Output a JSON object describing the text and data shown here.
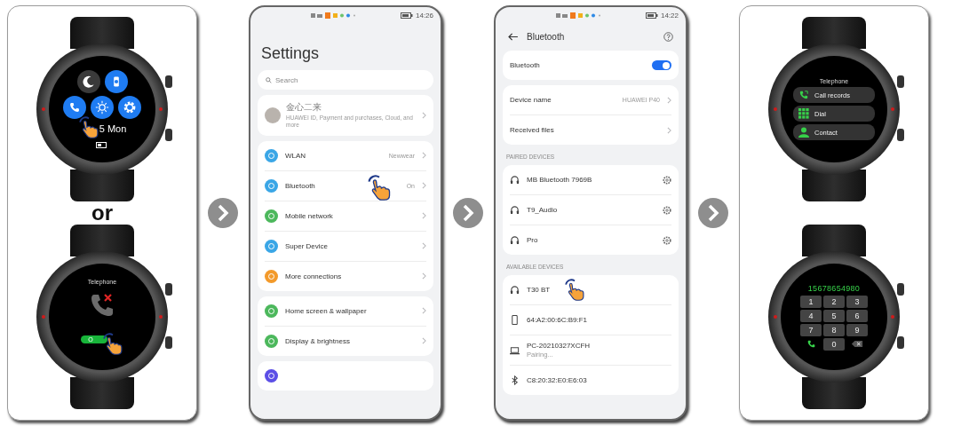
{
  "step_1": {
    "quick_menu_watch": {
      "date": "5 Mon",
      "tap": true
    },
    "separator": "or",
    "call_watch": {
      "title": "Telephone",
      "button_label": "O",
      "tap": true
    }
  },
  "step_2": {
    "status_time": "14:26",
    "title": "Settings",
    "search": {
      "placeholder": "Search"
    },
    "account": {
      "name": "金心二来",
      "subtitle": "HUAWEI ID, Payment and purchases, Cloud, and more"
    },
    "groups": [
      [
        {
          "label": "WLAN",
          "value": "Newwear",
          "color": "#3aa6e6",
          "tap": false
        },
        {
          "label": "Bluetooth",
          "value": "On",
          "color": "#3aa6e6",
          "tap": true
        },
        {
          "label": "Mobile network",
          "color": "#4cb85c",
          "tap": false
        },
        {
          "label": "Super Device",
          "color": "#3aa6e6",
          "tap": false
        },
        {
          "label": "More connections",
          "color": "#f39a2b",
          "tap": false
        }
      ],
      [
        {
          "label": "Home screen & wallpaper",
          "color": "#4cb85c",
          "tap": false
        },
        {
          "label": "Display & brightness",
          "color": "#4cb85c",
          "tap": false
        }
      ],
      [
        {
          "color": "#5b4ee6",
          "tap": false
        }
      ]
    ]
  },
  "step_3": {
    "status_time": "14:22",
    "title": "Bluetooth",
    "bluetooth": {
      "label": "Bluetooth",
      "on": true
    },
    "settings": [
      {
        "label": "Device name",
        "value": "HUAWEI P40"
      },
      {
        "label": "Received files"
      }
    ],
    "paired": {
      "heading": "PAIRED DEVICES",
      "devices": [
        {
          "kind": "headset",
          "name": "MB Bluetooth 7969B"
        },
        {
          "kind": "headset",
          "name": "T9_Audio"
        },
        {
          "kind": "headset",
          "name": "Pro"
        }
      ]
    },
    "available": {
      "heading": "AVAILABLE DEVICES",
      "devices": [
        {
          "kind": "headset",
          "name": "T30 BT",
          "tap": true
        },
        {
          "kind": "phone",
          "name": "64:A2:00:6C:B9:F1",
          "tap": false
        },
        {
          "kind": "computer",
          "name": "PC-20210327XCFH",
          "status": "Pairing...",
          "tap": false
        },
        {
          "kind": "bluetooth",
          "name": "C8:20:32:E0:E6:03",
          "tap": false
        }
      ]
    }
  },
  "step_4": {
    "menu_watch": {
      "title": "Telephone",
      "items": [
        {
          "kind": "call_records",
          "label": "Call records"
        },
        {
          "kind": "dial",
          "label": "Dial"
        },
        {
          "kind": "contact",
          "label": "Contact"
        }
      ]
    },
    "dialer_watch": {
      "number": "15678654980",
      "keys": [
        "1",
        "2",
        "3",
        "4",
        "5",
        "6",
        "7",
        "8",
        "9",
        "0"
      ]
    }
  }
}
